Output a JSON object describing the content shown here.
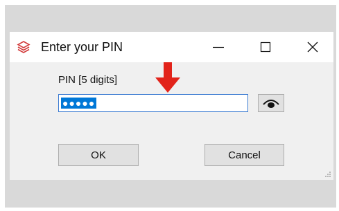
{
  "window": {
    "title": "Enter your PIN"
  },
  "title_controls": {
    "minimize_icon": "minimize-icon",
    "maximize_icon": "maximize-icon",
    "close_icon": "close-icon"
  },
  "form": {
    "pin_label": "PIN [5 digits]",
    "pin_value": "●●●●●",
    "eye_icon": "eye-icon",
    "arrow_icon": "down-arrow-icon",
    "arrow_color": "#e2231a"
  },
  "buttons": {
    "ok_label": "OK",
    "cancel_label": "Cancel"
  },
  "colors": {
    "app_icon": "#d23a3a",
    "selection": "#0078d7",
    "focus_border": "#3b7bd1"
  }
}
